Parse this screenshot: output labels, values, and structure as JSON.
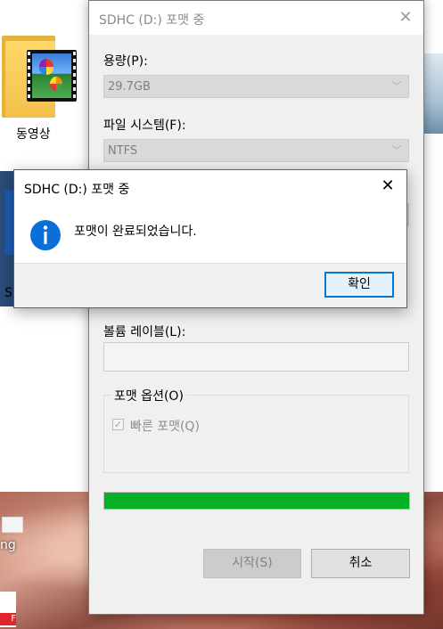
{
  "desktop": {
    "folder_label": "동영상",
    "partial_label_s": "S",
    "partial_label_ng": "ng",
    "partial_label_pdf": "F"
  },
  "format_window": {
    "title": "SDHC (D:) 포맷 중",
    "capacity_label": "용량(P):",
    "capacity_value": "29.7GB",
    "filesystem_label": "파일 시스템(F):",
    "filesystem_value": "NTFS",
    "volume_label_label": "볼륨 레이블(L):",
    "volume_label_value": "",
    "options_group_title": "포맷 옵션(O)",
    "quick_format_label": "빠른 포맷(Q)",
    "quick_format_checked": true,
    "progress_percent": 100,
    "start_button": "시작(S)",
    "cancel_button": "취소"
  },
  "message_box": {
    "title": "SDHC (D:) 포맷 중",
    "message": "포맷이 완료되었습니다.",
    "icon": "info-icon",
    "ok_button": "확인"
  },
  "colors": {
    "progress_fill": "#06b025",
    "info_icon": "#0a6fd8",
    "default_button_border": "#0078d7"
  }
}
